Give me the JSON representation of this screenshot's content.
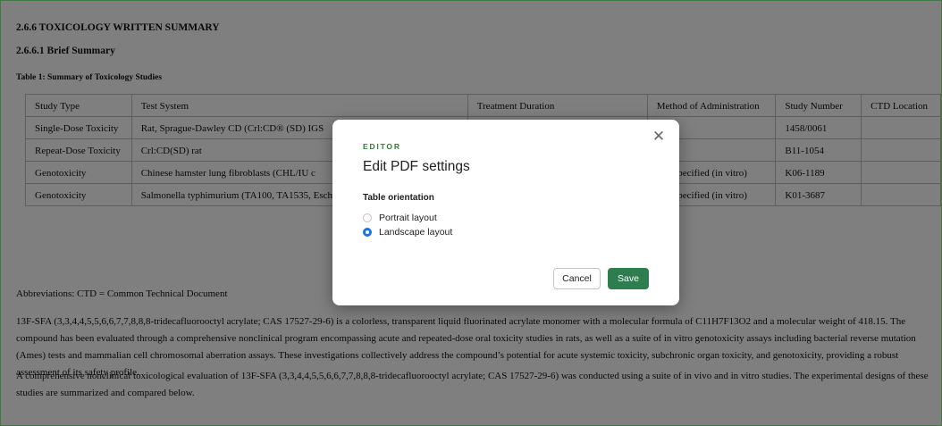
{
  "document": {
    "heading1": "2.6.6 TOXICOLOGY WRITTEN SUMMARY",
    "heading2": "2.6.6.1 Brief Summary",
    "table_caption": "Table 1:  Summary of Toxicology Studies",
    "table": {
      "headers": [
        "Study Type",
        "Test System",
        "Treatment Duration",
        "Method of Administration",
        "Study Number",
        "CTD Location"
      ],
      "rows": [
        [
          "Single-Dose Toxicity",
          "Rat, Sprague-Dawley CD (Crl:CD® (SD) IGS",
          "",
          "",
          "1458/0061",
          ""
        ],
        [
          "Repeat-Dose Toxicity",
          "Crl:CD(SD) rat",
          "",
          "",
          "B11-1054",
          ""
        ],
        [
          "Genotoxicity",
          "Chinese hamster lung fibroblasts (CHL/IU c",
          "",
          "Not specified (in vitro)",
          "K06-1189",
          ""
        ],
        [
          "Genotoxicity",
          "Salmonella typhimurium (TA100, TA1535, Escherichia coli (WP2uvrA)",
          "",
          "Not specified (in vitro)",
          "K01-3687",
          ""
        ]
      ]
    },
    "abbreviations": "Abbreviations: CTD = Common Technical Document",
    "paragraph1": "13F-SFA (3,3,4,4,5,5,6,6,7,7,8,8,8-tridecafluorooctyl acrylate; CAS 17527-29-6) is a colorless, transparent liquid fluorinated acrylate monomer with a molecular formula of C11H7F13O2 and a molecular weight of 418.15. The compound has been evaluated through a comprehensive nonclinical program encompassing acute and repeated-dose oral toxicity studies in rats, as well as a suite of in vitro genotoxicity assays including bacterial reverse mutation (Ames) tests and mammalian cell chromosomal aberration assays. These investigations collectively address the compound’s potential for acute systemic toxicity, subchronic organ toxicity, and genotoxicity, providing a robust assessment of its safety profile.",
    "paragraph2": "A comprehensive nonclinical toxicological evaluation of 13F-SFA (3,3,4,4,5,5,6,6,7,7,8,8,8-tridecafluorooctyl acrylate; CAS 17527-29-6) was conducted using a suite of in vivo and in vitro studies. The experimental designs of these studies are summarized and compared below."
  },
  "modal": {
    "kicker": "EDITOR",
    "title": "Edit PDF settings",
    "group_label": "Table orientation",
    "options": [
      {
        "label": "Portrait layout",
        "selected": false
      },
      {
        "label": "Landscape layout",
        "selected": true
      }
    ],
    "close_icon": "close-icon",
    "cancel_label": "Cancel",
    "save_label": "Save"
  },
  "colors": {
    "accent_green": "#2e7d4f",
    "radio_blue": "#1a73e8",
    "frame_border": "#3f7a3f"
  }
}
